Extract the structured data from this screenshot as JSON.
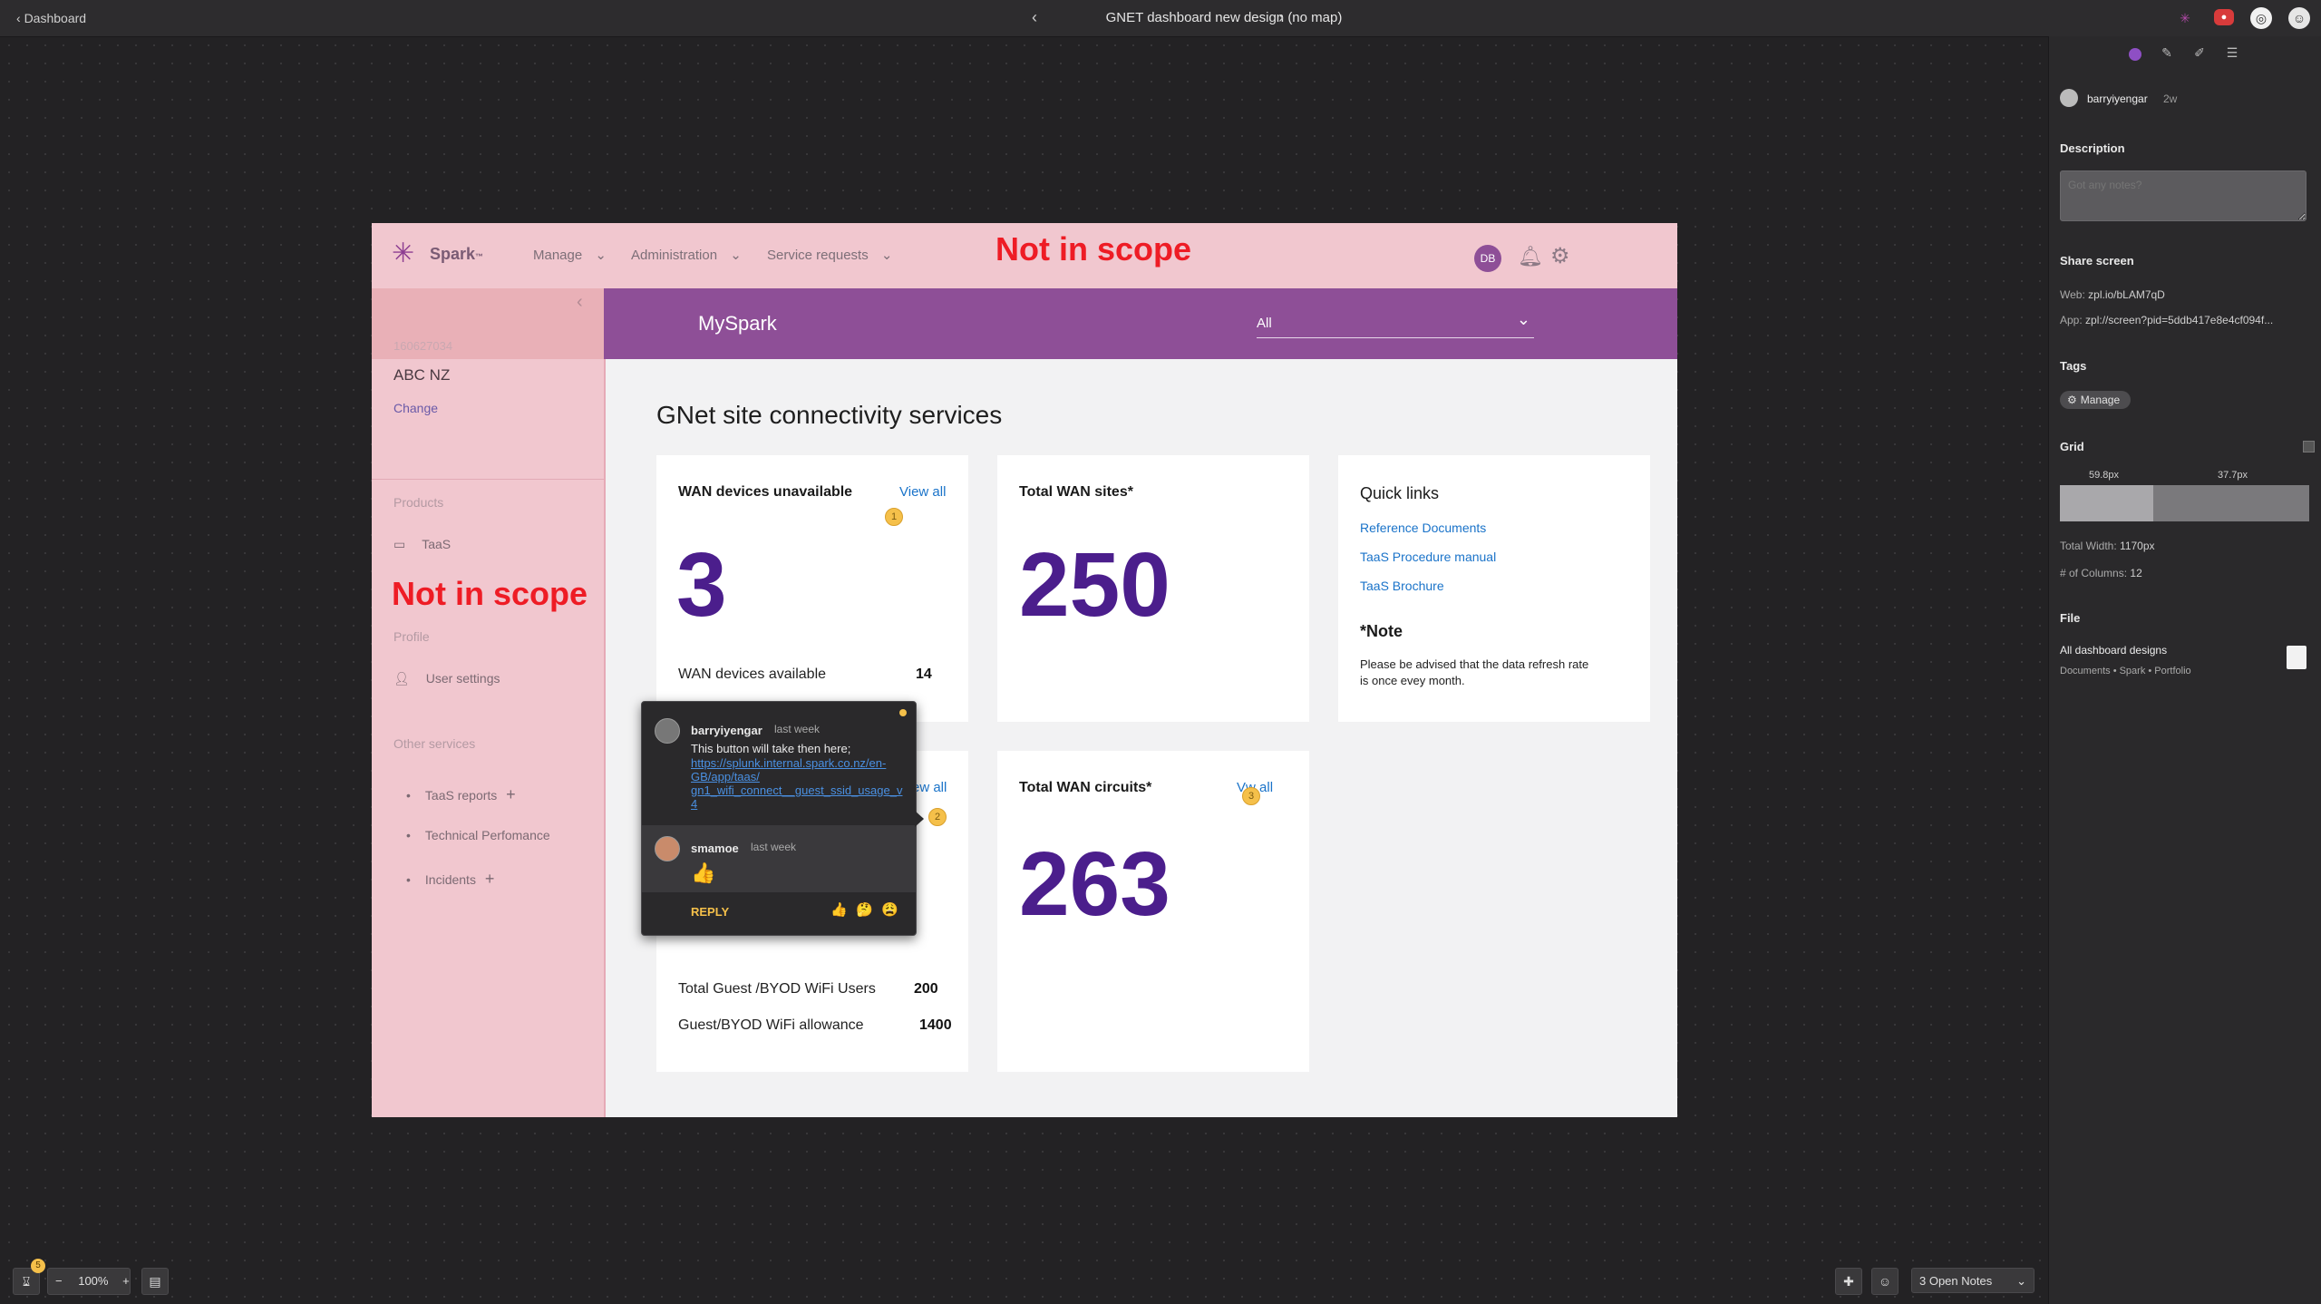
{
  "topbar": {
    "back_label": "Dashboard",
    "title": "GNET dashboard new design (no map)"
  },
  "right_panel": {
    "author": "barryiyengar",
    "author_time": "2w",
    "description_label": "Description",
    "description_placeholder": "Got any notes?",
    "share_label": "Share screen",
    "web_label": "Web:",
    "web_value": "zpl.io/bLAM7qD",
    "app_label": "App:",
    "app_value": "zpl://screen?pid=5ddb417e8e4cf094f...",
    "tags_label": "Tags",
    "tag": "Manage",
    "grid_label": "Grid",
    "grid_col1": "59.8px",
    "grid_col2": "37.7px",
    "total_width_label": "Total Width:",
    "total_width_value": "1170px",
    "columns_label": "# of Columns:",
    "columns_value": "12",
    "file_label": "File",
    "file_name": "All dashboard designs",
    "file_path": "Documents • Spark • Portfolio"
  },
  "design": {
    "brand": "Spark",
    "brand_tm": "™",
    "nav": [
      "Manage",
      "Administration",
      "Service requests"
    ],
    "not_in_scope_header": "Not in scope",
    "avatar_initials": "DB",
    "account_number": "160627034",
    "account_name": "ABC NZ",
    "change_link": "Change",
    "products_label": "Products",
    "taas_item": "TaaS",
    "not_in_scope_sidebar": "Not in scope",
    "profile_label": "Profile",
    "user_settings": "User settings",
    "other_services_label": "Other services",
    "other_services": [
      "TaaS reports",
      "Technical Perfomance",
      "Incidents"
    ],
    "myspark": "MySpark",
    "filter_value": "All",
    "page_title": "GNet site connectivity services",
    "card1": {
      "title": "WAN devices unavailable",
      "link": "View all",
      "big": "3",
      "row_label": "WAN devices available",
      "row_value": "14",
      "marker": "1"
    },
    "card2": {
      "title": "Total WAN sites*",
      "big": "250"
    },
    "card3": {
      "title": "Quick links",
      "links": [
        "Reference Documents",
        "TaaS Procedure manual",
        "TaaS Brochure"
      ],
      "note_title": "*Note",
      "note_body": "Please be advised that the data refresh rate is once evey month."
    },
    "card4": {
      "link_partial": "ew all",
      "marker": "2",
      "row1_label": "Total Guest /BYOD WiFi  Users",
      "row1_value": "200",
      "row2_label": "Guest/BYOD WiFi allowance",
      "row2_value": "1400"
    },
    "card5": {
      "title": "Total WAN circuits*",
      "link_partial": "w all",
      "link_prefix": "V",
      "marker": "3",
      "big": "263"
    }
  },
  "comment": {
    "c1_name": "barryiyengar",
    "c1_time": "last week",
    "c1_text": "This button will take then here;",
    "c1_link": "https://splunk.internal.spark.co.nz/en-GB/app/taas/gn1_wifi_connect__guest_ssid_usage_v4",
    "c1_link_lines": [
      "https://splunk.internal.spark.co.nz/en-",
      "GB/app/taas/",
      "gn1_wifi_connect__guest_ssid_usage_v",
      "4"
    ],
    "c2_name": "smamoe",
    "c2_time": "last week",
    "c2_emoji": "👍",
    "reply_label": "REPLY",
    "reactions": [
      "👍",
      "🤔",
      "😩"
    ]
  },
  "bottombar": {
    "zoom": "100%",
    "badge": "5",
    "notes_select": "3 Open Notes"
  },
  "colors": {
    "accent_purple": "#8e4f97",
    "big_number": "#4b1e8c",
    "not_in_scope": "#ee1c25",
    "link_blue": "#1a73c9",
    "pink_bg": "#f1c7cf"
  }
}
